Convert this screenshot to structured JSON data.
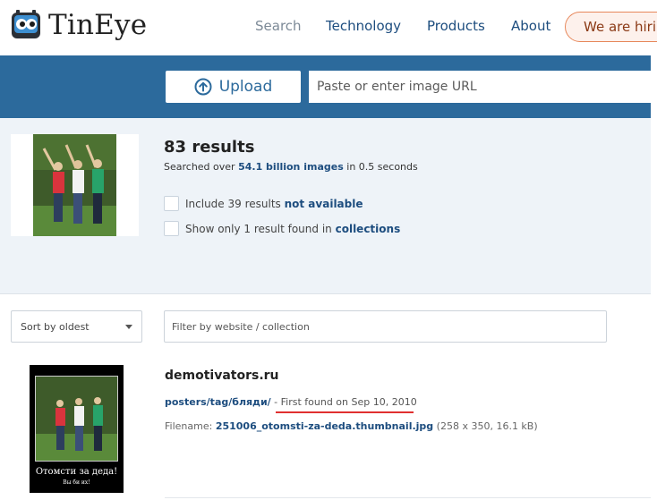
{
  "brand": {
    "name": "TinEye"
  },
  "nav": {
    "search": "Search",
    "technology": "Technology",
    "products": "Products",
    "about": "About",
    "hiring": "We are hiri"
  },
  "upload": {
    "button_label": "Upload",
    "url_placeholder": "Paste or enter image URL"
  },
  "results": {
    "count_title": "83 results",
    "searched_prefix": "Searched over ",
    "searched_highlight": "54.1 billion images",
    "searched_suffix": " in 0.5 seconds",
    "include_prefix": "Include 39 results ",
    "include_highlight": "not available",
    "collections_prefix": "Show only 1 result found in ",
    "collections_highlight": "collections"
  },
  "filters": {
    "sort_value": "Sort by oldest",
    "filter_placeholder": "Filter by website / collection"
  },
  "result_item": {
    "site": "demotivators.ru",
    "path": "posters/tag/бляди/",
    "first_found": " - First found on Sep 10, 2010",
    "filename_label": "Filename: ",
    "filename": "251006_otomsti-za-deda.thumbnail.jpg",
    "file_info": " (258 x 350, 16.1 kB)",
    "thumb_caption_1": "Отомсти за деда!",
    "thumb_caption_2": "Вы би их!"
  },
  "colors": {
    "brand_blue": "#2c6a9c",
    "link_blue": "#1d4d7f",
    "panel_bg": "#eef3f8",
    "hiring_border": "#e7875a",
    "annotation_red": "#e03030"
  }
}
